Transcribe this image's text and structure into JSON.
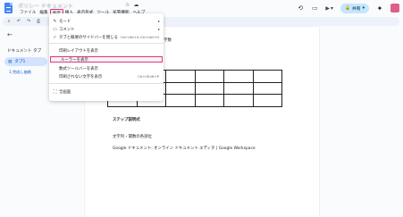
{
  "titlebar": {
    "title": "ポリシー ドキュメント",
    "menu": [
      "ファイル",
      "編集",
      "表示",
      "挿入",
      "表示形式",
      "ツール",
      "拡張機能",
      "ヘルプ"
    ],
    "active_menu_index": 2,
    "share_label": "共有"
  },
  "sidebar": {
    "outline_title": "ドキュメント タブ",
    "tab_label": "タブ1",
    "sub_label": "1.完成し価格"
  },
  "dropdown": {
    "items": [
      {
        "label": "モード",
        "shortcut": "",
        "icon": "pencil-icon",
        "submenu": true
      },
      {
        "label": "コメント",
        "shortcut": "",
        "icon": "comment-icon",
        "submenu": true
      },
      {
        "label": "タブと概要のサイドバーを閉じる",
        "shortcut": "Ctrl+Alt+A Ctrl+Alt+H",
        "icon": "check-icon",
        "submenu": false
      },
      {
        "label": "印刷レイアウトを表示",
        "shortcut": "",
        "icon": "",
        "submenu": false
      },
      {
        "label": "ルーラーを表示",
        "shortcut": "",
        "icon": "",
        "submenu": false
      },
      {
        "label": "数式ツールバーを表示",
        "shortcut": "",
        "icon": "",
        "submenu": false
      },
      {
        "label": "印刷されない文字を表示",
        "shortcut": "Ctrl+Shift+P",
        "icon": "",
        "submenu": false
      },
      {
        "label": "全画面",
        "shortcut": "",
        "icon": "fullscreen-icon",
        "submenu": false
      }
    ],
    "highlighted_index": 4
  },
  "document": {
    "heading": "ランダム・数値を表記する文字数",
    "section1": "ステップ説明式",
    "section2": "文字列・関数の各部位",
    "footer_line": "Google ドキュメント: オンライン ドキュメント エディタ | Google Workspace"
  },
  "colors": {
    "highlight": "#e8317f",
    "accent": "#0b57d0",
    "share_bg": "#c2e7ff"
  }
}
